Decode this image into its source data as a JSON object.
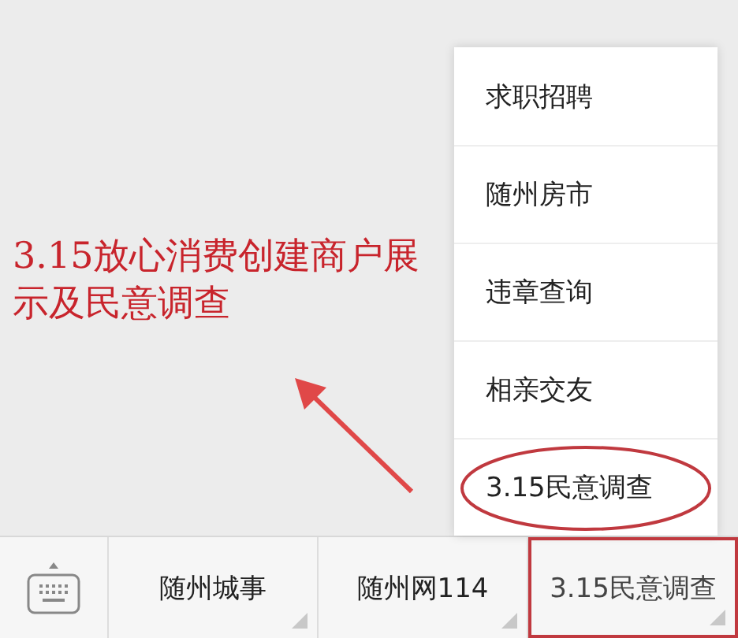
{
  "annotation": {
    "text": "3.15放心消费创建商户展示及民意调查"
  },
  "popup_menu": {
    "items": [
      {
        "label": "求职招聘",
        "highlighted": false
      },
      {
        "label": "随州房市",
        "highlighted": false
      },
      {
        "label": "违章查询",
        "highlighted": false
      },
      {
        "label": "相亲交友",
        "highlighted": false
      },
      {
        "label": "3.15民意调查",
        "highlighted": true
      }
    ]
  },
  "bottom_menu": {
    "tabs": [
      {
        "label": "随州城事",
        "highlighted": false
      },
      {
        "label": "随州网114",
        "highlighted": false
      },
      {
        "label": "3.15民意调查",
        "highlighted": true
      }
    ]
  }
}
